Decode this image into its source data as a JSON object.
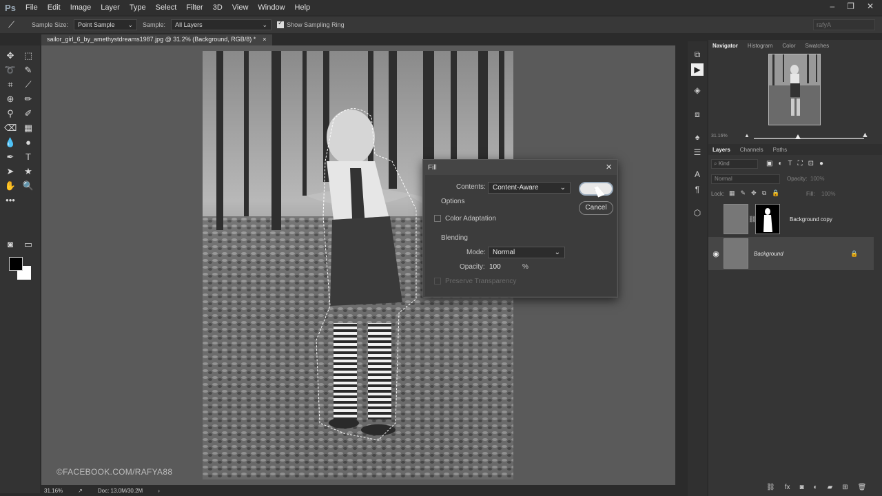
{
  "app": {
    "logo": "Ps"
  },
  "menu": [
    "File",
    "Edit",
    "Image",
    "Layer",
    "Type",
    "Select",
    "Filter",
    "3D",
    "View",
    "Window",
    "Help"
  ],
  "options_bar": {
    "sample_size_label": "Sample Size:",
    "sample_size_value": "Point Sample",
    "sample_label": "Sample:",
    "sample_value": "All Layers",
    "show_ring_label": "Show Sampling Ring",
    "user_field": "rafyA"
  },
  "document": {
    "tab_title": "sailor_girl_6_by_amethystdreams1987.jpg @ 31.2% (Background, RGB/8) *",
    "close_glyph": "×",
    "watermark": "©FACEBOOK.COM/RAFYA88"
  },
  "status": {
    "zoom": "31.16%",
    "doc": "Doc: 13.0M/30.2M"
  },
  "navigator": {
    "tabs": [
      "Navigator",
      "Histogram",
      "Color",
      "Swatches"
    ],
    "zoom": "31.16%"
  },
  "layers_panel": {
    "tabs": [
      "Layers",
      "Channels",
      "Paths"
    ],
    "kind_placeholder": "Kind",
    "blend_mode": "Normal",
    "opacity_label": "Opacity:",
    "opacity_value": "100%",
    "lock_label": "Lock:",
    "fill_label": "Fill:",
    "fill_value": "100%",
    "layers": [
      {
        "name": "Background copy",
        "visible": false,
        "selected": false
      },
      {
        "name": "Background",
        "visible": true,
        "selected": true
      }
    ]
  },
  "fill_dialog": {
    "title": "Fill",
    "contents_label": "Contents:",
    "contents_value": "Content-Aware",
    "ok_label": "OK",
    "cancel_label": "Cancel",
    "options_header": "Options",
    "color_adaptation": "Color Adaptation",
    "blending_header": "Blending",
    "mode_label": "Mode:",
    "mode_value": "Normal",
    "opacity_label": "Opacity:",
    "opacity_value": "100",
    "percent": "%",
    "preserve_transparency": "Preserve Transparency"
  }
}
